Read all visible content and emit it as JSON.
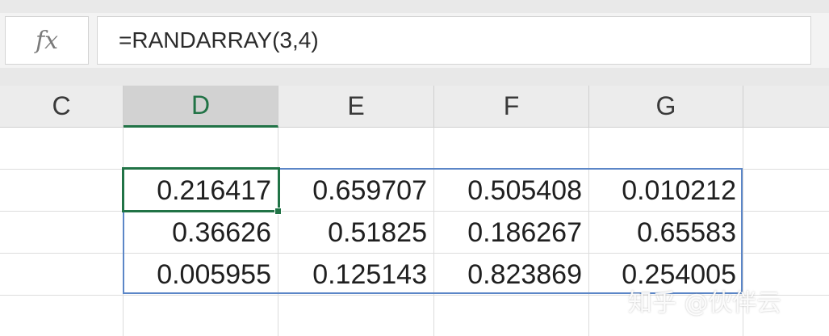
{
  "formula_bar": {
    "fx_label": "fx",
    "formula": "=RANDARRAY(3,4)"
  },
  "columns": [
    {
      "label": "C",
      "selected": false
    },
    {
      "label": "D",
      "selected": true
    },
    {
      "label": "E",
      "selected": false
    },
    {
      "label": "F",
      "selected": false
    },
    {
      "label": "G",
      "selected": false
    }
  ],
  "grid": {
    "rows": [
      [
        "",
        "",
        "",
        "",
        ""
      ],
      [
        "",
        "0.216417",
        "0.659707",
        "0.505408",
        "0.010212"
      ],
      [
        "",
        "0.36626",
        "0.51825",
        "0.186267",
        "0.65583"
      ],
      [
        "",
        "0.005955",
        "0.125143",
        "0.823869",
        "0.254005"
      ],
      [
        "",
        "",
        "",
        "",
        ""
      ]
    ]
  },
  "active_cell": {
    "column": "D",
    "value": "0.216417"
  },
  "watermark": "知乎 @伙伴云",
  "colors": {
    "selection_green": "#217346",
    "spill_blue": "#5b86c7",
    "header_bg": "#ececec",
    "gridline": "#dcdcdc"
  }
}
